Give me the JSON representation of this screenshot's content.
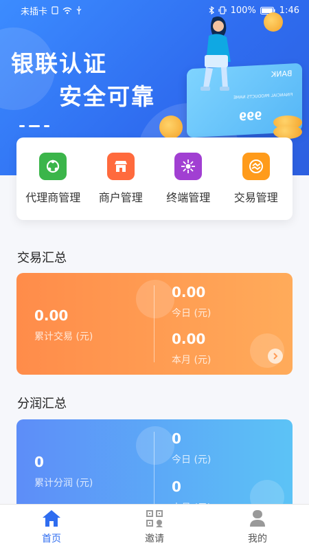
{
  "status_bar": {
    "carrier": "未插卡",
    "battery": "100%",
    "time": "1:46"
  },
  "banner": {
    "title_line1": "银联认证",
    "title_line2": "安全可靠",
    "card_brand": "BANK",
    "card_subtitle": "FINANCIAL PRODUCTS NAME",
    "card_number": "999"
  },
  "menu": [
    {
      "label": "代理商管理",
      "icon": "agent-icon",
      "color": "#3bb54a"
    },
    {
      "label": "商户管理",
      "icon": "store-icon",
      "color": "#ff6a3d"
    },
    {
      "label": "终端管理",
      "icon": "terminal-icon",
      "color": "#a13fd2"
    },
    {
      "label": "交易管理",
      "icon": "trade-icon",
      "color": "#ff9b1b"
    }
  ],
  "trade_summary": {
    "title": "交易汇总",
    "total_value": "0.00",
    "total_label": "累计交易 (元)",
    "today_value": "0.00",
    "today_label": "今日 (元)",
    "month_value": "0.00",
    "month_label": "本月 (元)"
  },
  "profit_summary": {
    "title": "分润汇总",
    "total_value": "0",
    "total_label": "累计分润 (元)",
    "today_value": "0",
    "today_label": "今日 (元)",
    "month_value": "0",
    "month_label": "本月 (元)"
  },
  "bottom_nav": [
    {
      "label": "首页",
      "icon": "home-icon",
      "active": true
    },
    {
      "label": "邀请",
      "icon": "qr-code-icon",
      "active": false
    },
    {
      "label": "我的",
      "icon": "user-icon",
      "active": false
    }
  ],
  "colors": {
    "primary": "#2f6df0",
    "trade_gradient_start": "#ff8c4a",
    "profit_gradient_start": "#5d8df8"
  }
}
